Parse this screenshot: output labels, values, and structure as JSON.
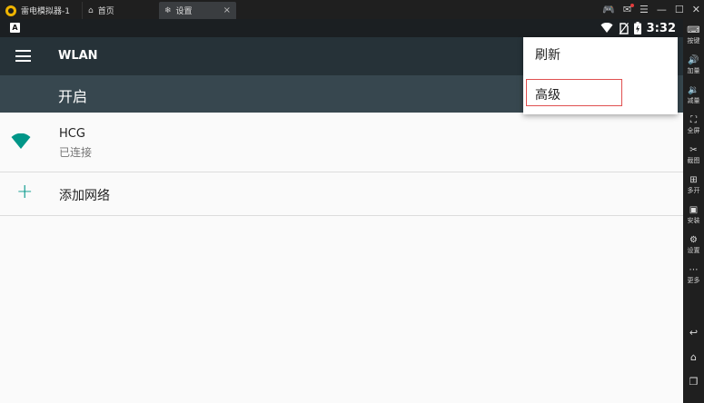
{
  "emulator": {
    "app_tab": "雷电模拟器-1",
    "home_tab": "首页",
    "settings_tab": "设置",
    "close_glyph": "×",
    "controls": [
      "🎮",
      "✉",
      "☰",
      "—",
      "☐",
      "✕"
    ],
    "sidebar": [
      {
        "label": "按键",
        "icon": "⌨"
      },
      {
        "label": "加量",
        "icon": "🔊"
      },
      {
        "label": "减量",
        "icon": "🔉"
      },
      {
        "label": "全屏",
        "icon": "⛶"
      },
      {
        "label": "截图",
        "icon": "✂"
      },
      {
        "label": "多开",
        "icon": "⊞"
      },
      {
        "label": "安装",
        "icon": "▣"
      },
      {
        "label": "设置",
        "icon": "⚙"
      },
      {
        "label": "更多",
        "icon": "⋯"
      }
    ],
    "nav": [
      "↩",
      "⌂",
      "❐"
    ]
  },
  "status_bar": {
    "indicator": "A",
    "time": "3:32"
  },
  "app_bar": {
    "title": "WLAN"
  },
  "master_switch": {
    "label": "开启"
  },
  "networks": [
    {
      "name": "HCG",
      "status": "已连接"
    }
  ],
  "add_network": {
    "icon": "+",
    "label": "添加网络"
  },
  "overflow_menu": {
    "items": [
      "刷新",
      "高级"
    ]
  },
  "colors": {
    "toolbar": "#263238",
    "switchbar": "#37474f",
    "accent": "#009688",
    "highlight": "#e05050"
  }
}
